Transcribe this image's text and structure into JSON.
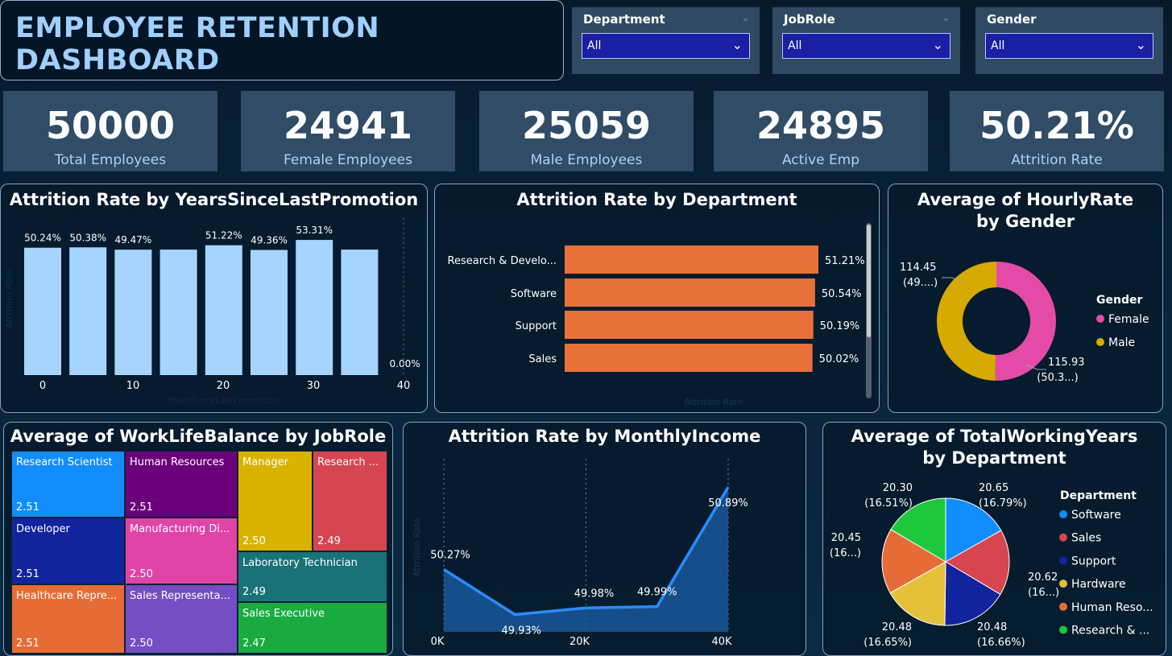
{
  "header": {
    "title": "EMPLOYEE RETENTION DASHBOARD"
  },
  "filters": [
    {
      "label": "Department",
      "value": "All"
    },
    {
      "label": "JobRole",
      "value": "All"
    },
    {
      "label": "Gender",
      "value": "All"
    }
  ],
  "kpis": [
    {
      "value": "50000",
      "label": "Total Employees"
    },
    {
      "value": "24941",
      "label": "Female Employees"
    },
    {
      "value": "25059",
      "label": "Male Employees"
    },
    {
      "value": "24895",
      "label": "Active Emp"
    },
    {
      "value": "50.21%",
      "label": "Attrition Rate"
    }
  ],
  "icons": {
    "dropdown": "chevron-down-icon"
  },
  "colors": {
    "bar_promo": "#a6d4ff",
    "bar_dept": "#e8703a",
    "female": "#e44ba8",
    "male": "#d6aa00",
    "area_line": "#2a8cff"
  },
  "chart_data": [
    {
      "id": "promo",
      "type": "bar",
      "title": "Attrition Rate by YearsSinceLastPromotion",
      "xlabel": "YearsSinceLastPromotion",
      "ylabel": "Attrition Rate",
      "x_ticks": [
        "0",
        "10",
        "20",
        "30",
        "40"
      ],
      "values": [
        50.24,
        50.38,
        49.47,
        49.5,
        51.22,
        49.36,
        53.31,
        49.5,
        0.0
      ],
      "data_labels": [
        "50.24%",
        "50.38%",
        "49.47%",
        "",
        "51.22%",
        "49.36%",
        "53.31%",
        "",
        "0.00%"
      ],
      "ylim": [
        0,
        60
      ]
    },
    {
      "id": "dept",
      "type": "bar",
      "orientation": "horizontal",
      "title": "Attrition Rate by Department",
      "xlabel": "Attrition Rate",
      "categories": [
        "Research & Develo...",
        "Software",
        "Support",
        "Sales"
      ],
      "values": [
        51.21,
        50.54,
        50.19,
        50.02
      ],
      "data_labels": [
        "51.21%",
        "50.54%",
        "50.19%",
        "50.02%"
      ]
    },
    {
      "id": "hourly",
      "type": "pie",
      "variant": "donut",
      "title": "Average of HourlyRate by Gender",
      "legend_title": "Gender",
      "categories": [
        "Female",
        "Male"
      ],
      "values": [
        115.93,
        114.45
      ],
      "data_labels": [
        "115.93",
        "114.45"
      ],
      "pct_labels": [
        "(50.3...)",
        "(49....)"
      ],
      "legend": "right"
    },
    {
      "id": "worklife",
      "type": "treemap",
      "title": "Average of WorkLifeBalance by JobRole",
      "categories": [
        "Research Scientist",
        "Human Resources",
        "Manager",
        "Research ...",
        "Developer",
        "Manufacturing Di...",
        "Laboratory Technician",
        "Healthcare Repre...",
        "Sales Representa...",
        "Sales Executive"
      ],
      "values": [
        2.51,
        2.51,
        2.5,
        2.49,
        2.51,
        2.5,
        2.49,
        2.51,
        2.5,
        2.47
      ],
      "colors": [
        "#118dff",
        "#6b007b",
        "#d9b300",
        "#d64550",
        "#12239e",
        "#e044a7",
        "#197278",
        "#e66c37",
        "#744ec2",
        "#1aab40"
      ]
    },
    {
      "id": "income",
      "type": "area",
      "title": "Attrition Rate by MonthlyIncome",
      "ylabel": "Attrition Rate",
      "x_ticks": [
        "0K",
        "20K",
        "40K"
      ],
      "x": [
        0,
        10000,
        20000,
        30000,
        40000
      ],
      "values": [
        50.27,
        49.93,
        49.98,
        49.99,
        50.89
      ],
      "data_labels": [
        "50.27%",
        "49.93%",
        "49.98%",
        "49.99%",
        "50.89%"
      ],
      "ylim": [
        49.8,
        51.0
      ]
    },
    {
      "id": "workyears",
      "type": "pie",
      "title": "Average of TotalWorkingYears by Department",
      "legend_title": "Department",
      "categories": [
        "Software",
        "Sales",
        "Support",
        "Hardware",
        "Human Reso...",
        "Research & ..."
      ],
      "values": [
        20.65,
        20.62,
        20.48,
        20.48,
        20.45,
        20.3
      ],
      "data_labels": [
        "20.65",
        "20.62",
        "20.48",
        "20.48",
        "20.45",
        "20.30"
      ],
      "pct_labels": [
        "(16.79%)",
        "(16...)",
        "(16.66%)",
        "(16.65%)",
        "(16...)",
        "(16.51%)"
      ],
      "colors": [
        "#118dff",
        "#d64550",
        "#12239e",
        "#e6c03a",
        "#e66c37",
        "#1ec83c"
      ],
      "legend": "right"
    }
  ]
}
